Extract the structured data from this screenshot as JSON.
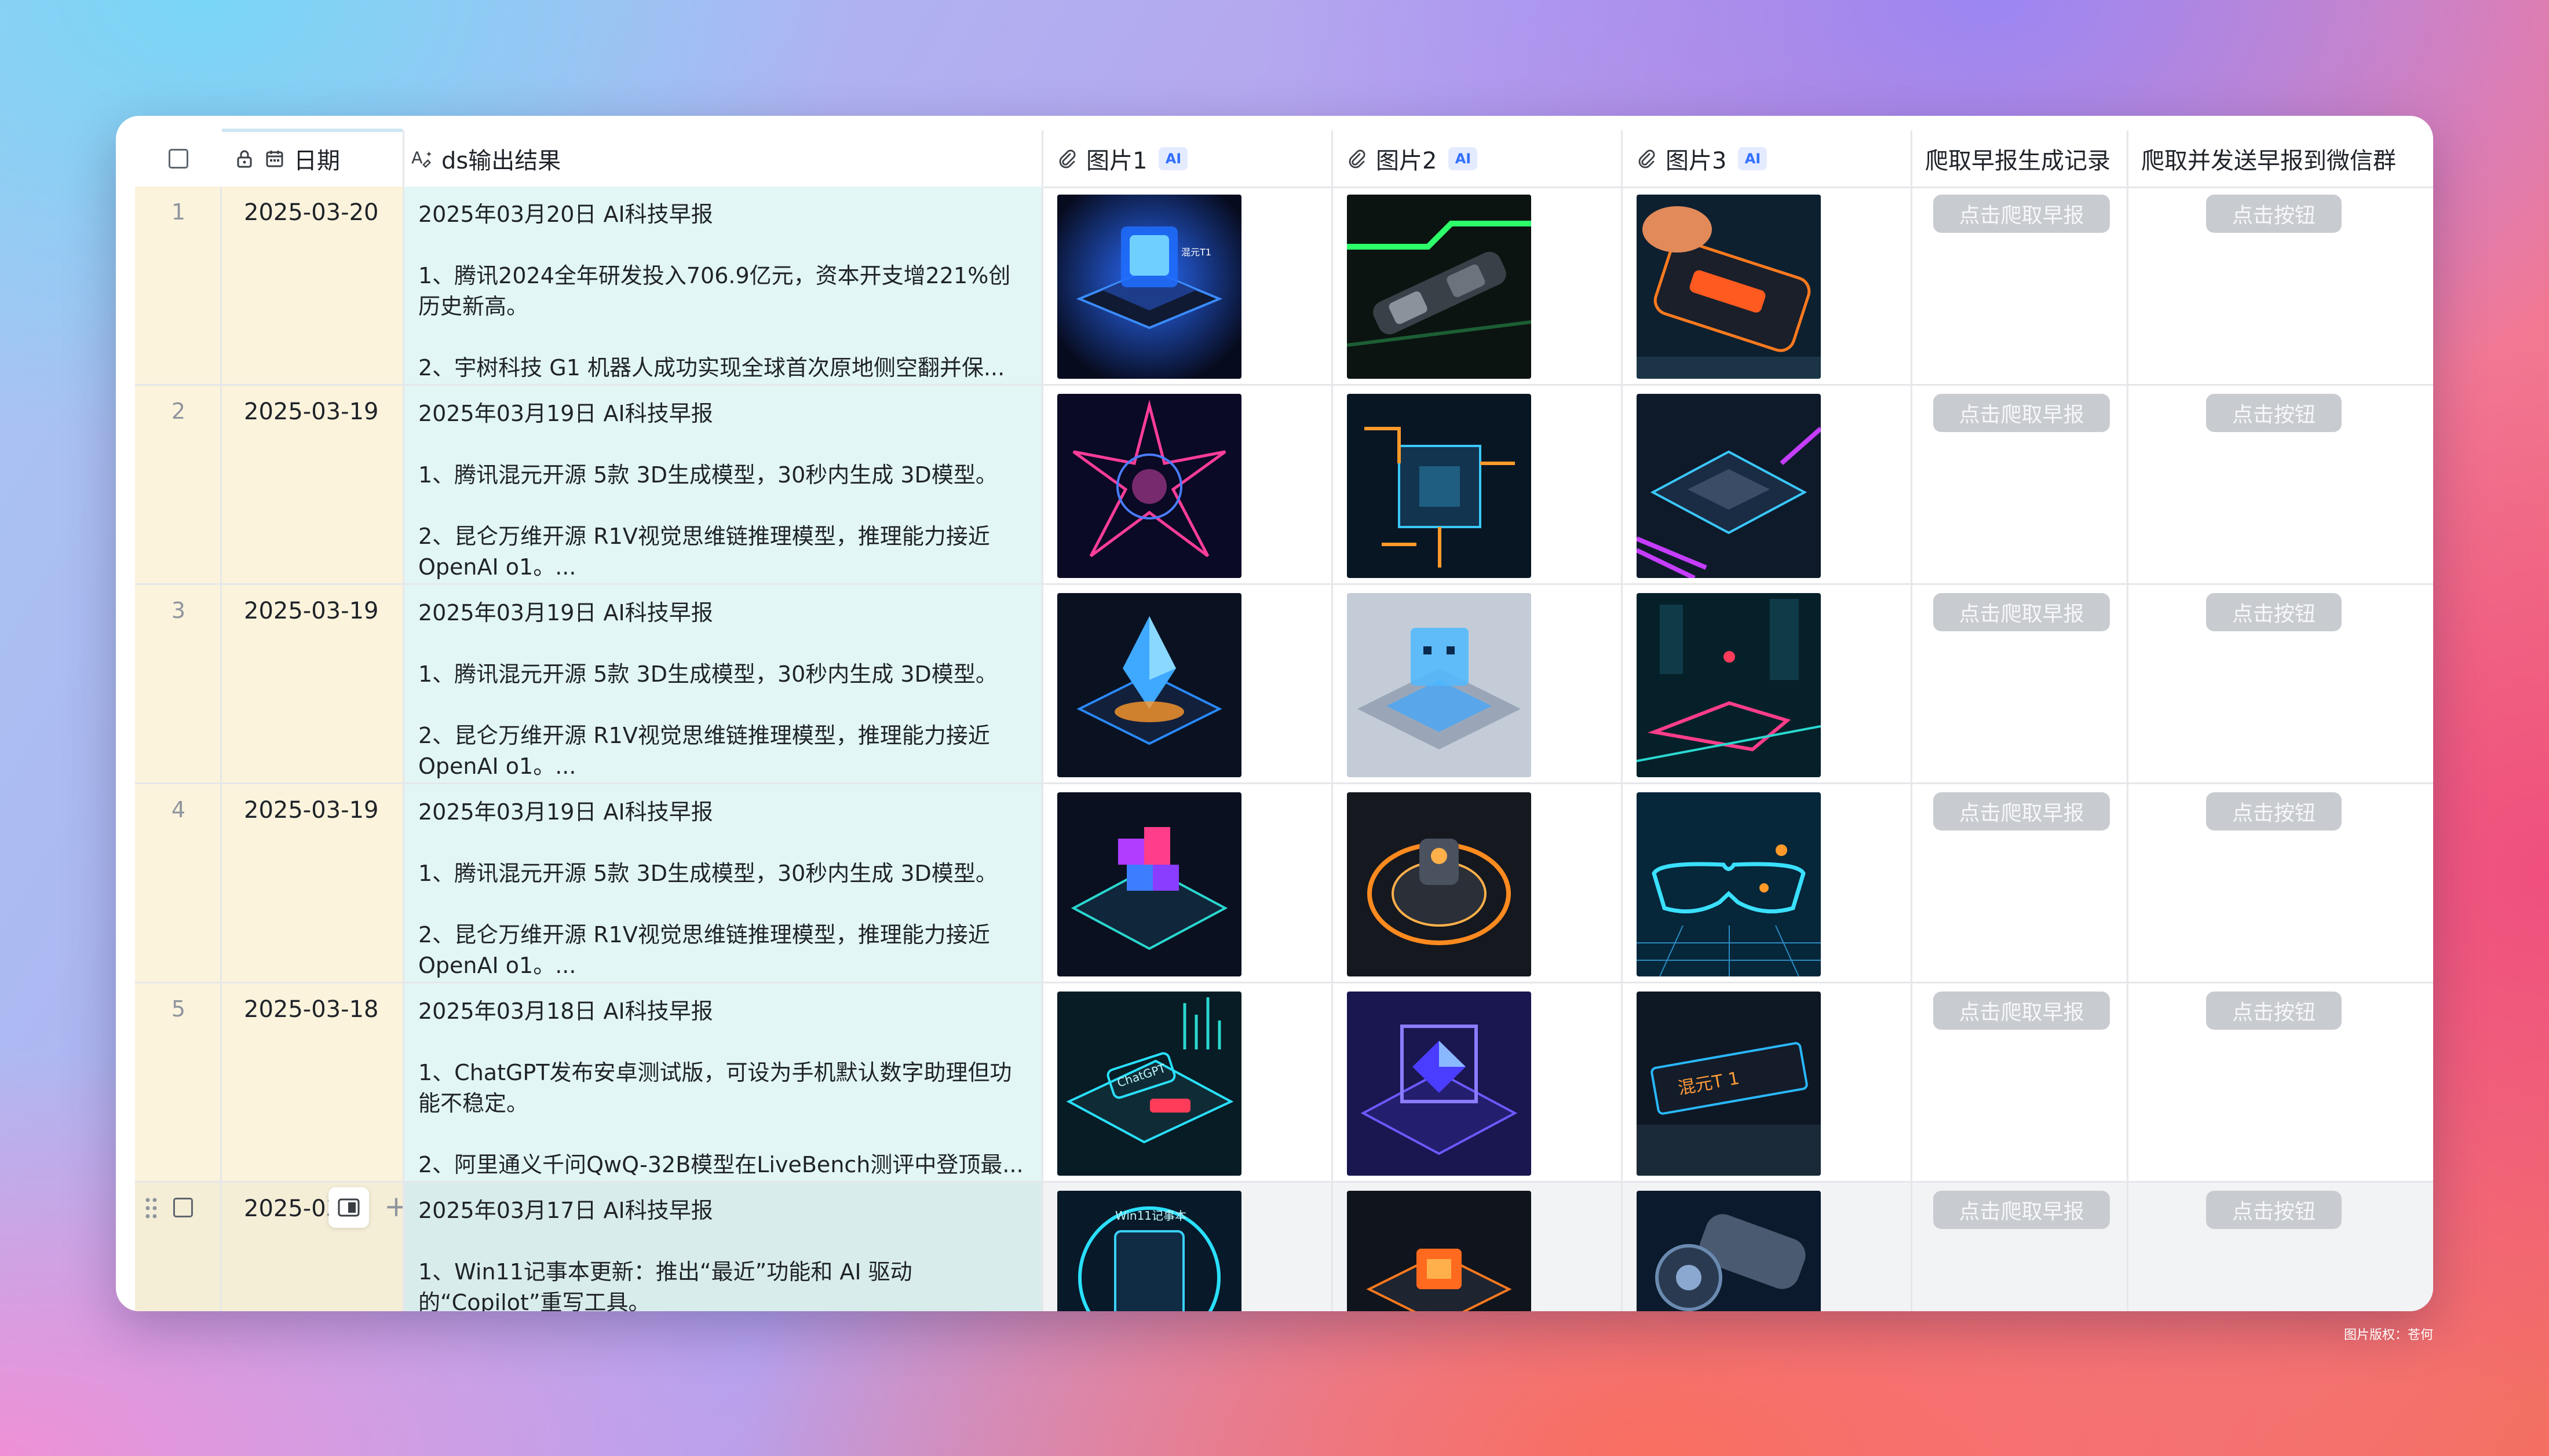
{
  "header": {
    "date_label": "日期",
    "text_label": "ds输出结果",
    "img1_label": "图片1",
    "img2_label": "图片2",
    "img3_label": "图片3",
    "ai_badge": "AI",
    "crawl_label": "爬取早报生成记录",
    "send_label": "爬取并发送早报到微信群"
  },
  "buttons": {
    "crawl": "点击爬取早报",
    "send": "点击按钮"
  },
  "rows": [
    {
      "index": "1",
      "date": "2025-03-20",
      "title": "2025年03月20日 AI科技早报",
      "item1": "1、腾讯2024全年研发投入706.9亿元，资本开支增221%创历史新高。",
      "item2": "2、宇树科技 G1 机器人成功实现全球首次原地侧空翻并保..."
    },
    {
      "index": "2",
      "date": "2025-03-19",
      "title": "2025年03月19日 AI科技早报",
      "item1": "1、腾讯混元开源 5款 3D生成模型，30秒内生成 3D模型。",
      "item2": "2、昆仑万维开源 R1V视觉思维链推理模型，推理能力接近 OpenAI o1。..."
    },
    {
      "index": "3",
      "date": "2025-03-19",
      "title": "2025年03月19日 AI科技早报",
      "item1": "1、腾讯混元开源 5款 3D生成模型，30秒内生成 3D模型。",
      "item2": "2、昆仑万维开源 R1V视觉思维链推理模型，推理能力接近 OpenAI o1。..."
    },
    {
      "index": "4",
      "date": "2025-03-19",
      "title": "2025年03月19日 AI科技早报",
      "item1": "1、腾讯混元开源 5款 3D生成模型，30秒内生成 3D模型。",
      "item2": "2、昆仑万维开源 R1V视觉思维链推理模型，推理能力接近 OpenAI o1。..."
    },
    {
      "index": "5",
      "date": "2025-03-18",
      "title": "2025年03月18日 AI科技早报",
      "item1": "1、ChatGPT发布安卓测试版，可设为手机默认数字助理但功能不稳定。",
      "item2": "2、阿里通义千问QwQ-32B模型在LiveBench测评中登顶最..."
    },
    {
      "date": "2025-03",
      "title": "2025年03月17日 AI科技早报",
      "item1": "1、Win11记事本更新：推出“最近”功能和 AI 驱动的“Copilot”重写工具。",
      "item2": ""
    }
  ],
  "image_texts": {
    "r1_img1": "混元T1",
    "r5_img1": "ChatGPT",
    "r5_img3": "混元T 1",
    "r6_img1": "Win11记事本"
  },
  "colors": {
    "index_col_bg": "#fbf3dc",
    "text_col_bg": "#e2f6f5",
    "button_bg": "#c8cbd0",
    "ai_badge": "#3370ff"
  },
  "footer": {
    "copyright": "图片版权：苍何"
  }
}
